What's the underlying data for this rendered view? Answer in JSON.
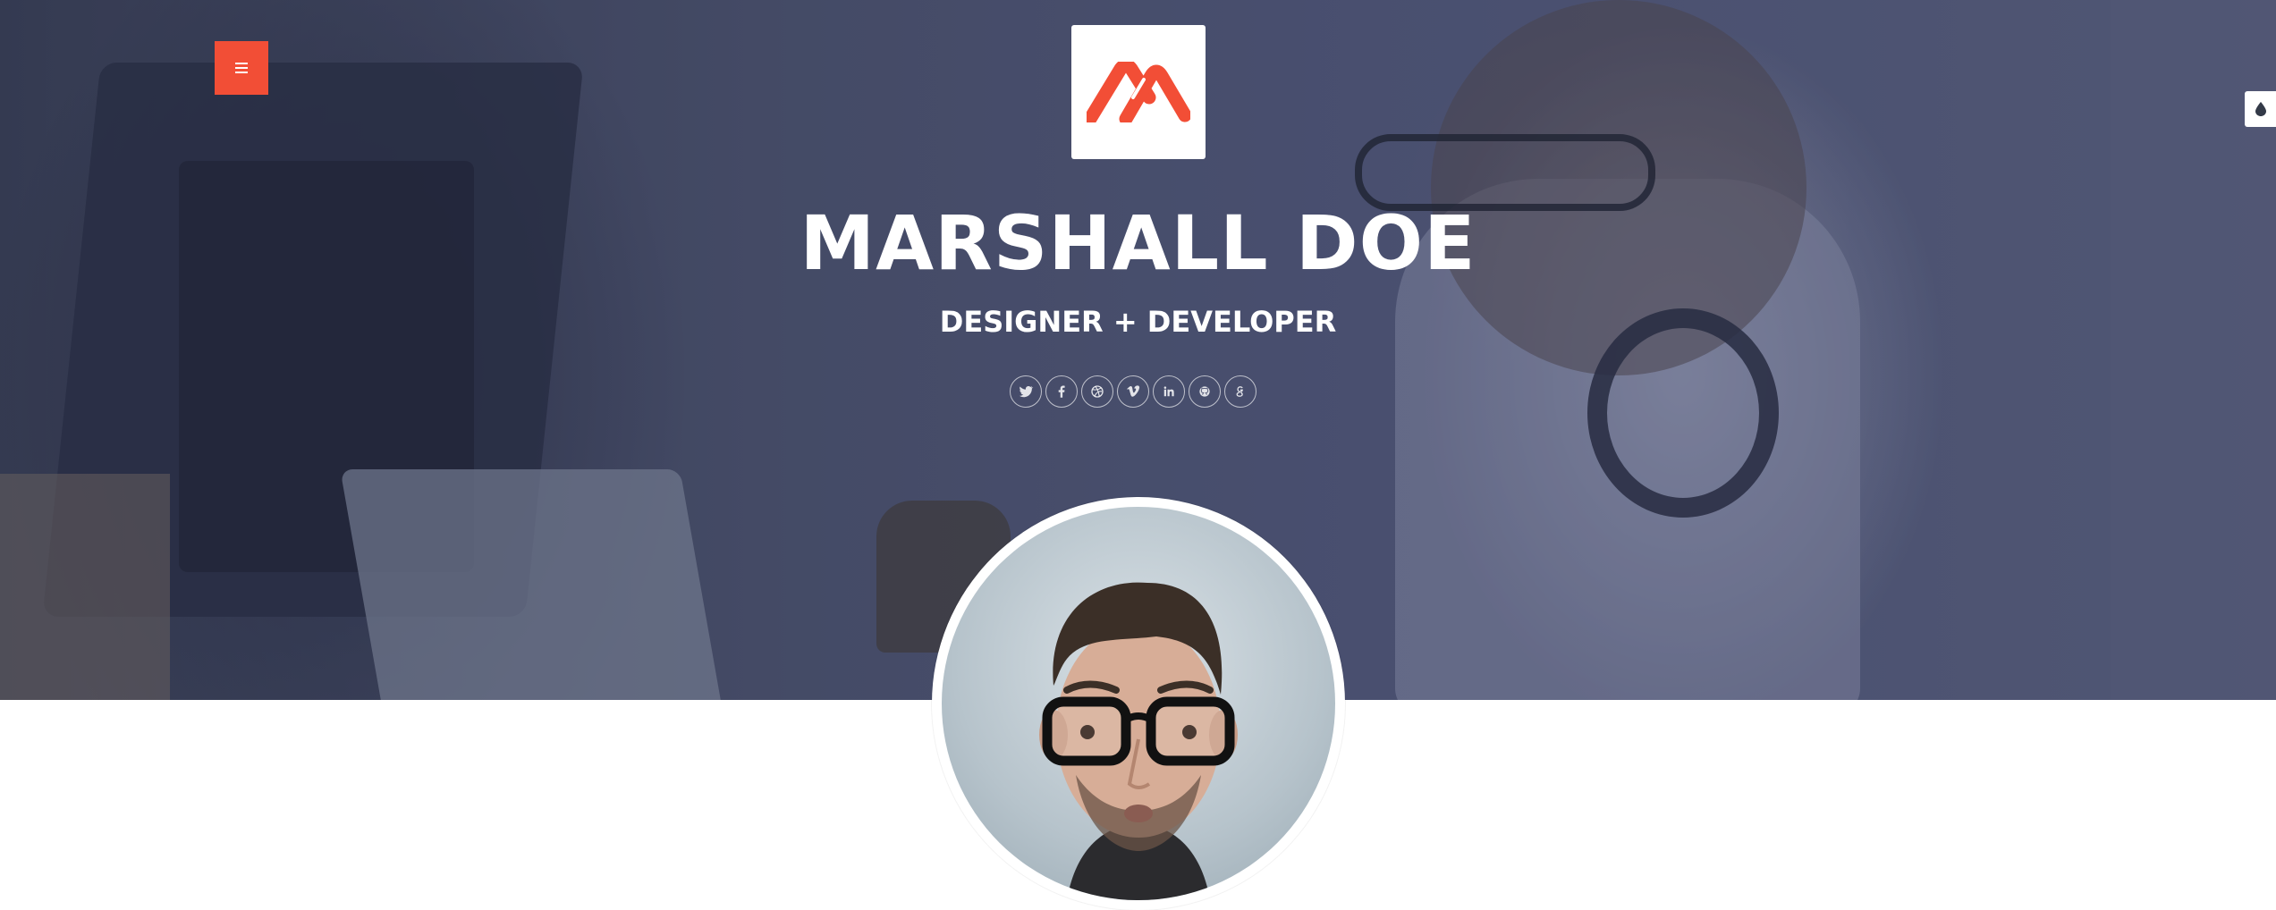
{
  "header": {
    "menu_icon": "hamburger-icon",
    "theme_switch_icon": "droplet-icon",
    "accent_color": "#f24e36"
  },
  "profile": {
    "name": "MARSHALL DOE",
    "tagline": "DESIGNER + DEVELOPER"
  },
  "social": [
    {
      "network": "twitter",
      "icon": "twitter-icon"
    },
    {
      "network": "facebook",
      "icon": "facebook-icon"
    },
    {
      "network": "dribbble",
      "icon": "dribbble-icon"
    },
    {
      "network": "vimeo",
      "icon": "vimeo-icon"
    },
    {
      "network": "linkedin",
      "icon": "linkedin-icon"
    },
    {
      "network": "github",
      "icon": "github-icon"
    },
    {
      "network": "google-plus",
      "icon": "google-plus-icon"
    }
  ]
}
